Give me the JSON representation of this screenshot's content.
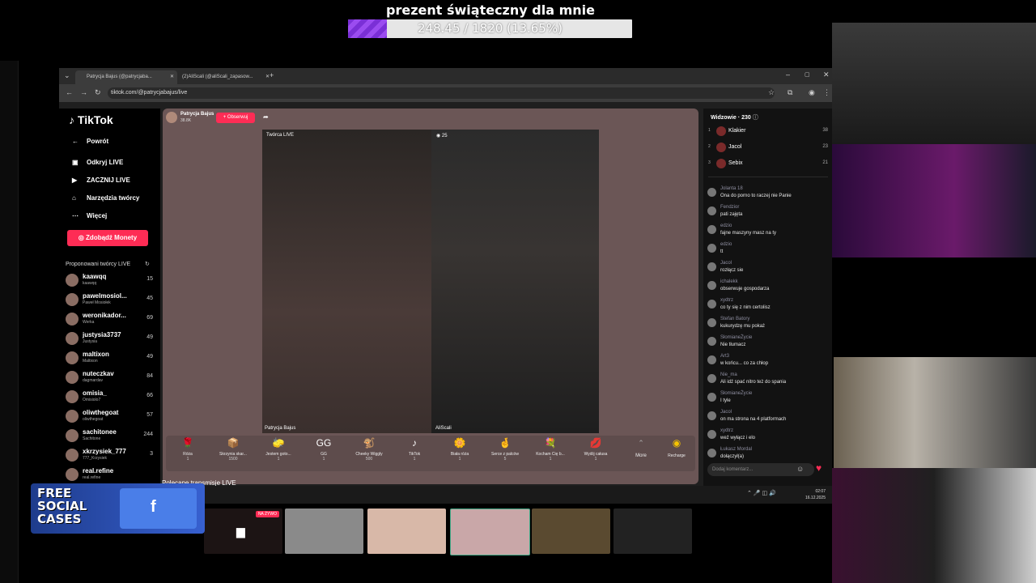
{
  "overlay": {
    "goal_title": "prezent świąteczny dla mnie",
    "goal_text": "248.45 / 1820 (13.65%)",
    "goal_progress_percent": 13.65
  },
  "browser": {
    "tabs": [
      {
        "label": "Patrycja Bajus (@patrycjaba..."
      },
      {
        "label": "(2)AliScali (@aliScali_zapasow..."
      }
    ],
    "url": "tiktok.com/@patrycjabajus/live"
  },
  "sidebar": {
    "logo": "TikTok",
    "nav": [
      {
        "label": "Powrót",
        "icon": "back-icon"
      },
      {
        "label": "Odkryj LIVE",
        "icon": "live-icon"
      },
      {
        "label": "ZACZNIJ LIVE",
        "icon": "camera-icon"
      },
      {
        "label": "Narzędzia twórcy",
        "icon": "home-icon"
      },
      {
        "label": "Więcej",
        "icon": "more-icon"
      }
    ],
    "coins_button": "Zdobądź Monety",
    "suggested_title": "Proponowani twórcy LIVE",
    "creators": [
      {
        "name": "kaawqq",
        "sub": "kaawqq",
        "count": "15"
      },
      {
        "name": "pawelmosiol...",
        "sub": "Paweł Mosiołek",
        "count": "45"
      },
      {
        "name": "weronikador...",
        "sub": "Werka",
        "count": "69"
      },
      {
        "name": "justysia3737",
        "sub": "Justysia",
        "count": "49"
      },
      {
        "name": "maltixon",
        "sub": "Maltixon",
        "count": "49"
      },
      {
        "name": "nuteczkav",
        "sub": "dagmardav",
        "count": "84"
      },
      {
        "name": "omisia_",
        "sub": "Omisiolo7",
        "count": "66"
      },
      {
        "name": "oliwthegoat",
        "sub": "oliwthegoat",
        "count": "57"
      },
      {
        "name": "sachitonee",
        "sub": "Sachitone",
        "count": "244"
      },
      {
        "name": "xkrzysiek_777",
        "sub": "777_Krzysiek",
        "count": "3"
      },
      {
        "name": "real.refine",
        "sub": "real.refine",
        "count": ""
      }
    ]
  },
  "live": {
    "host_name": "Patrycja Bajus",
    "host_likes": "38.8K",
    "follow_label": "+ Obserwuj",
    "creator_label": "Twórca LIVE",
    "viewer_count_badge": "25",
    "left_name": "Patrycja Bajus",
    "right_name": "AliScali",
    "gifts": [
      {
        "name": "Róża",
        "price": "1",
        "icon": "🌹"
      },
      {
        "name": "Skrzynia skar...",
        "price": "1500",
        "icon": "📦"
      },
      {
        "name": "Jestem goto...",
        "price": "1",
        "icon": "🧽"
      },
      {
        "name": "GG",
        "price": "1",
        "icon": "GG"
      },
      {
        "name": "Cheeky Wiggly",
        "price": "500",
        "icon": "🐒"
      },
      {
        "name": "TikTok",
        "price": "1",
        "icon": "♪"
      },
      {
        "name": "Biała róża",
        "price": "1",
        "icon": "🌼"
      },
      {
        "name": "Serce z palców",
        "price": "5",
        "icon": "🤞"
      },
      {
        "name": "Kocham Cię b...",
        "price": "1",
        "icon": "💐"
      },
      {
        "name": "Wyślij całusa",
        "price": "1",
        "icon": "💋"
      }
    ],
    "more_label": "More",
    "recharge_label": "Recharge"
  },
  "chat": {
    "viewers_title": "Widzowie",
    "viewers_count": "230",
    "top_viewers": [
      {
        "rank": "1",
        "name": "Klakier",
        "score": "38"
      },
      {
        "rank": "2",
        "name": "Jacol",
        "score": "23"
      },
      {
        "rank": "3",
        "name": "Sebix",
        "score": "21"
      }
    ],
    "messages": [
      {
        "user": "Jolanta 18",
        "text": "Ona do porno to raczej nie Panie"
      },
      {
        "user": "Fendzior",
        "text": "pati zajęta"
      },
      {
        "user": "edzio",
        "text": "fajne maszyny masz na ty"
      },
      {
        "user": "edzio",
        "text": "tt"
      },
      {
        "user": "Jacol",
        "text": "rozłącz sie"
      },
      {
        "user": "ichalekk",
        "text": "obserwuje gospodarza"
      },
      {
        "user": "xydtrz",
        "text": "co ty się z nim certolisz"
      },
      {
        "user": "Stefan Batory",
        "text": "kukurydzę mu pokaż"
      },
      {
        "user": "SłomianeŻycie",
        "text": "Nie tłumacz"
      },
      {
        "user": "Art3",
        "text": "w końcu... co za chłop"
      },
      {
        "user": "Nie_ma",
        "text": "Ali idź spać nitro też do spania"
      },
      {
        "user": "SłomianeŻycie",
        "text": "I tyle"
      },
      {
        "user": "Jacol",
        "text": "on ma strona na 4 platformach"
      },
      {
        "user": "xydtrz",
        "text": "weź wyłącz i elo"
      },
      {
        "user": "Łukasz Mordal",
        "text": "dołączył(a)"
      }
    ],
    "input_placeholder": "Dodaj komentarz..."
  },
  "taskbar": {
    "time": "02:07",
    "date": "16.12.2025"
  },
  "recommended_title": "Polecane transmisje LIVE",
  "live_badge": "NA ŻYWO",
  "free_cases": {
    "line1": "FREE",
    "line2": "SOCIAL",
    "line3": "CASES"
  }
}
